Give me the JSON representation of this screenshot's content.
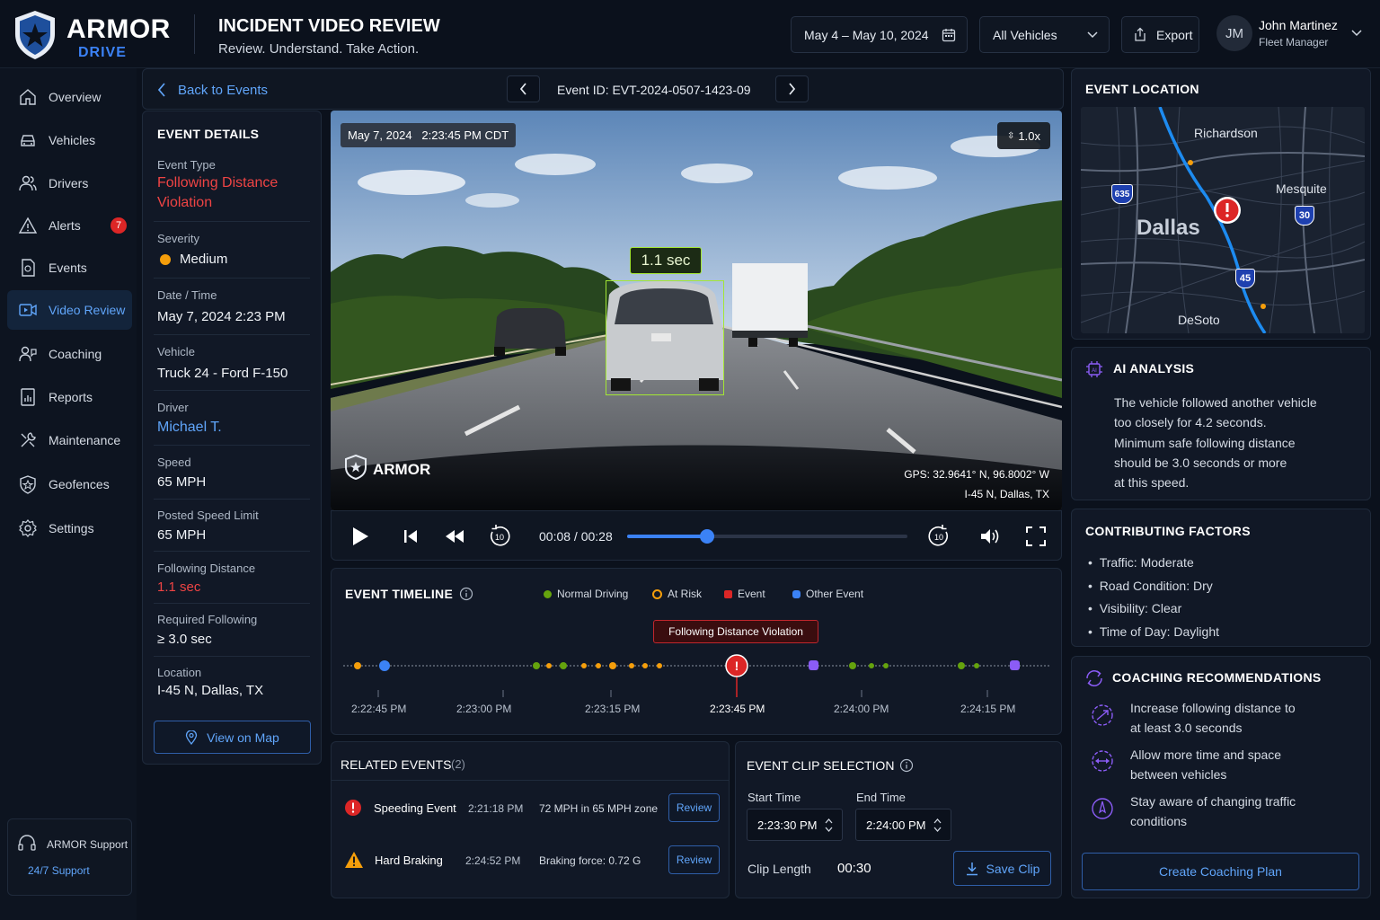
{
  "brand": {
    "name": "ARMOR",
    "sub": "DRIVE"
  },
  "header": {
    "title": "INCIDENT VIDEO REVIEW",
    "subtitle": "Review. Understand. Take Action.",
    "date_range": "May 4 – May 10, 2024",
    "vehicle_filter": "All Vehicles",
    "export_label": "Export",
    "user": {
      "initials": "JM",
      "name": "John Martinez",
      "role": "Fleet Manager"
    }
  },
  "sidebar": {
    "items": [
      {
        "label": "Overview",
        "icon": "home-icon"
      },
      {
        "label": "Vehicles",
        "icon": "car-icon"
      },
      {
        "label": "Drivers",
        "icon": "users-icon"
      },
      {
        "label": "Alerts",
        "icon": "alert-icon",
        "badge": "7"
      },
      {
        "label": "Events",
        "icon": "events-icon"
      },
      {
        "label": "Video Review",
        "icon": "video-icon",
        "active": true
      },
      {
        "label": "Coaching",
        "icon": "coaching-icon"
      },
      {
        "label": "Reports",
        "icon": "reports-icon"
      },
      {
        "label": "Maintenance",
        "icon": "wrench-icon"
      },
      {
        "label": "Geofences",
        "icon": "geofence-icon"
      },
      {
        "label": "Settings",
        "icon": "gear-icon"
      }
    ],
    "support": {
      "title": "ARMOR Support",
      "link": "24/7 Support"
    }
  },
  "nav": {
    "back_label": "Back to Events",
    "event_id": "Event ID: EVT-2024-0507-1423-09"
  },
  "event_details": {
    "title": "EVENT DETAILS",
    "event_type_label": "Event Type",
    "event_type_line1": "Following Distance",
    "event_type_line2": "Violation",
    "severity_label": "Severity",
    "severity_value": "Medium",
    "datetime_label": "Date / Time",
    "datetime_value": "May 7, 2024 2:23 PM",
    "vehicle_label": "Vehicle",
    "vehicle_value": "Truck 24 - Ford F-150",
    "driver_label": "Driver",
    "driver_value": "Michael T.",
    "speed_label": "Speed",
    "speed_value": "65 MPH",
    "limit_label": "Posted Speed Limit",
    "limit_value": "65 MPH",
    "following_label": "Following Distance",
    "following_value": "1.1 sec",
    "required_label": "Required Following",
    "required_value": "≥ 3.0 sec",
    "location_label": "Location",
    "location_value": "I-45 N, Dallas, TX",
    "map_button": "View on Map"
  },
  "video": {
    "timestamp": "May 7, 2024   2:23:45 PM CDT",
    "speed": "1.0x",
    "overlay_label": "1.1 sec",
    "watermark": "ARMOR",
    "gps": "GPS: 32.9641° N, 96.8002° W",
    "road": "I-45 N, Dallas, TX",
    "time": "00:08 / 00:28",
    "progress": 0.2857
  },
  "timeline": {
    "title": "EVENT TIMELINE",
    "legend": [
      {
        "label": "Normal Driving",
        "color": "#65a30d"
      },
      {
        "label": "At Risk",
        "color": "#f59e0b"
      },
      {
        "label": "Event",
        "color": "#dc2626"
      },
      {
        "label": "Other Event",
        "color": "#3b82f6"
      }
    ],
    "callout": "Following Distance Violation",
    "ticks": [
      "2:22:45 PM",
      "2:23:00 PM",
      "2:23:15 PM",
      "2:23:45 PM",
      "2:24:00 PM",
      "2:24:15 PM"
    ]
  },
  "related": {
    "title": "RELATED EVENTS",
    "count": "(2)",
    "rows": [
      {
        "name": "Speeding Event",
        "time": "2:21:18 PM",
        "detail": "72 MPH in 65 MPH zone",
        "action": "Review"
      },
      {
        "name": "Hard Braking",
        "time": "2:24:52 PM",
        "detail": "Braking force: 0.72 G",
        "action": "Review"
      }
    ]
  },
  "clip": {
    "title": "EVENT CLIP SELECTION",
    "start_label": "Start Time",
    "start_value": "2:23:30 PM",
    "end_label": "End Time",
    "end_value": "2:24:00 PM",
    "length_label": "Clip Length",
    "length_value": "00:30",
    "save_label": "Save Clip"
  },
  "location": {
    "title": "EVENT LOCATION",
    "cities": {
      "richardson": "Richardson",
      "mesquite": "Mesquite",
      "dallas": "Dallas",
      "desoto": "DeSoto"
    },
    "shields": {
      "i635": "635",
      "i30": "30",
      "i45": "45"
    }
  },
  "ai": {
    "title": "AI ANALYSIS",
    "lines": [
      "The vehicle followed another vehicle",
      "too closely for 4.2 seconds.",
      "Minimum safe following distance",
      "should be 3.0 seconds or more",
      "at this speed."
    ]
  },
  "factors": {
    "title": "CONTRIBUTING FACTORS",
    "items": [
      "Traffic: Moderate",
      "Road Condition: Dry",
      "Visibility: Clear",
      "Time of Day: Daylight"
    ]
  },
  "coaching": {
    "title": "COACHING RECOMMENDATIONS",
    "items": [
      {
        "line1": "Increase following distance to",
        "line2": "at least 3.0 seconds"
      },
      {
        "line1": "Allow more time and space",
        "line2": "between vehicles"
      },
      {
        "line1": "Stay aware of changing traffic",
        "line2": "conditions"
      }
    ],
    "button": "Create Coaching Plan"
  }
}
